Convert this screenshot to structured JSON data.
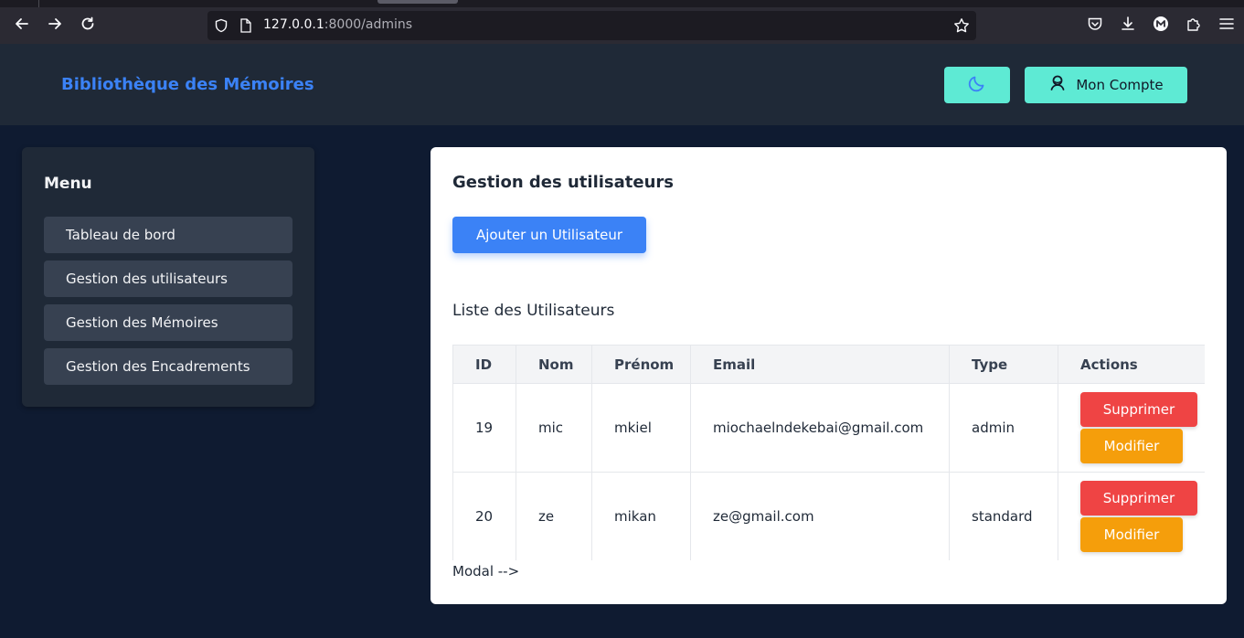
{
  "browser": {
    "url_host": "127.0.0.1",
    "url_path": ":8000/admins"
  },
  "header": {
    "brand": "Bibliothèque des Mémoires",
    "account_label": "Mon Compte"
  },
  "sidebar": {
    "title": "Menu",
    "items": [
      {
        "label": "Tableau de bord"
      },
      {
        "label": "Gestion des utilisateurs"
      },
      {
        "label": "Gestion des Mémoires"
      },
      {
        "label": "Gestion des Encadrements"
      }
    ]
  },
  "main": {
    "title": "Gestion des utilisateurs",
    "add_button": "Ajouter un Utilisateur",
    "list_title": "Liste des Utilisateurs",
    "columns": [
      "ID",
      "Nom",
      "Prénom",
      "Email",
      "Type",
      "Actions"
    ],
    "rows": [
      {
        "id": "19",
        "nom": "mic",
        "prenom": "mkiel",
        "email": "miochaelndekebai@gmail.com",
        "type": "admin",
        "delete": "Supprimer",
        "edit": "Modifier"
      },
      {
        "id": "20",
        "nom": "ze",
        "prenom": "mikan",
        "email": "ze@gmail.com",
        "type": "standard",
        "delete": "Supprimer",
        "edit": "Modifier"
      }
    ],
    "modal_note": "Modal -->"
  },
  "colors": {
    "accent": "#3b82f6",
    "teal": "#5eead4",
    "danger": "#ef4444",
    "warning": "#f59e0b",
    "background": "#0f1b31",
    "header_bg": "#1f2937"
  },
  "icons": {
    "theme": "moon-icon",
    "account": "user-icon"
  }
}
